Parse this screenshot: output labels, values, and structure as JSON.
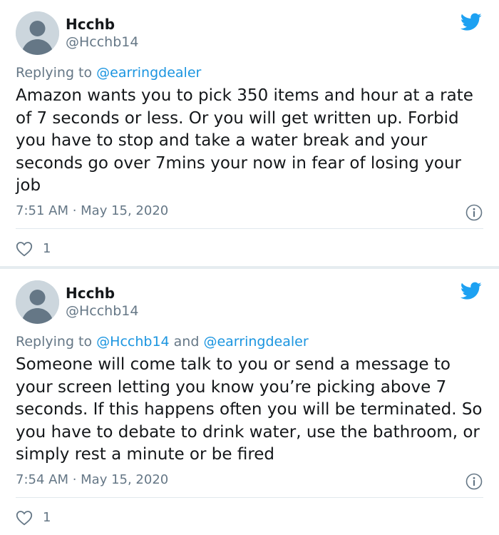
{
  "tweets": [
    {
      "author_name": "Hcchb",
      "author_handle": "@Hcchb14",
      "reply_prefix": "Replying to ",
      "reply_mentions": [
        "@earringdealer"
      ],
      "reply_connector": "",
      "text": "Amazon wants you to pick 350 items and hour at a rate of 7 seconds or less. Or you will get written up. Forbid you have to stop and take a water break and your seconds go over 7mins your now in fear of losing your job",
      "timestamp": "7:51 AM · May 15, 2020",
      "likes": "1"
    },
    {
      "author_name": "Hcchb",
      "author_handle": "@Hcchb14",
      "reply_prefix": "Replying to ",
      "reply_mentions": [
        "@Hcchb14",
        "@earringdealer"
      ],
      "reply_connector": " and ",
      "text": "Someone will come talk to you or send a message to your screen letting you know you’re picking above 7 seconds. If this happens often you will be terminated. So you have to debate to drink water, use the bathroom, or simply rest a minute or be fired",
      "timestamp": "7:54 AM · May 15, 2020",
      "likes": "1"
    }
  ],
  "icons": {
    "brand": "twitter-bird-icon",
    "info": "info-icon",
    "like": "heart-icon",
    "avatar": "default-avatar"
  },
  "colors": {
    "brand_blue": "#1da1f2",
    "link_blue": "#1b95e0",
    "text_primary": "#14171a",
    "text_secondary": "#657786",
    "divider": "#e1e8ed",
    "separator": "#e6ecf0",
    "avatar_bg": "#ccd6dd"
  }
}
